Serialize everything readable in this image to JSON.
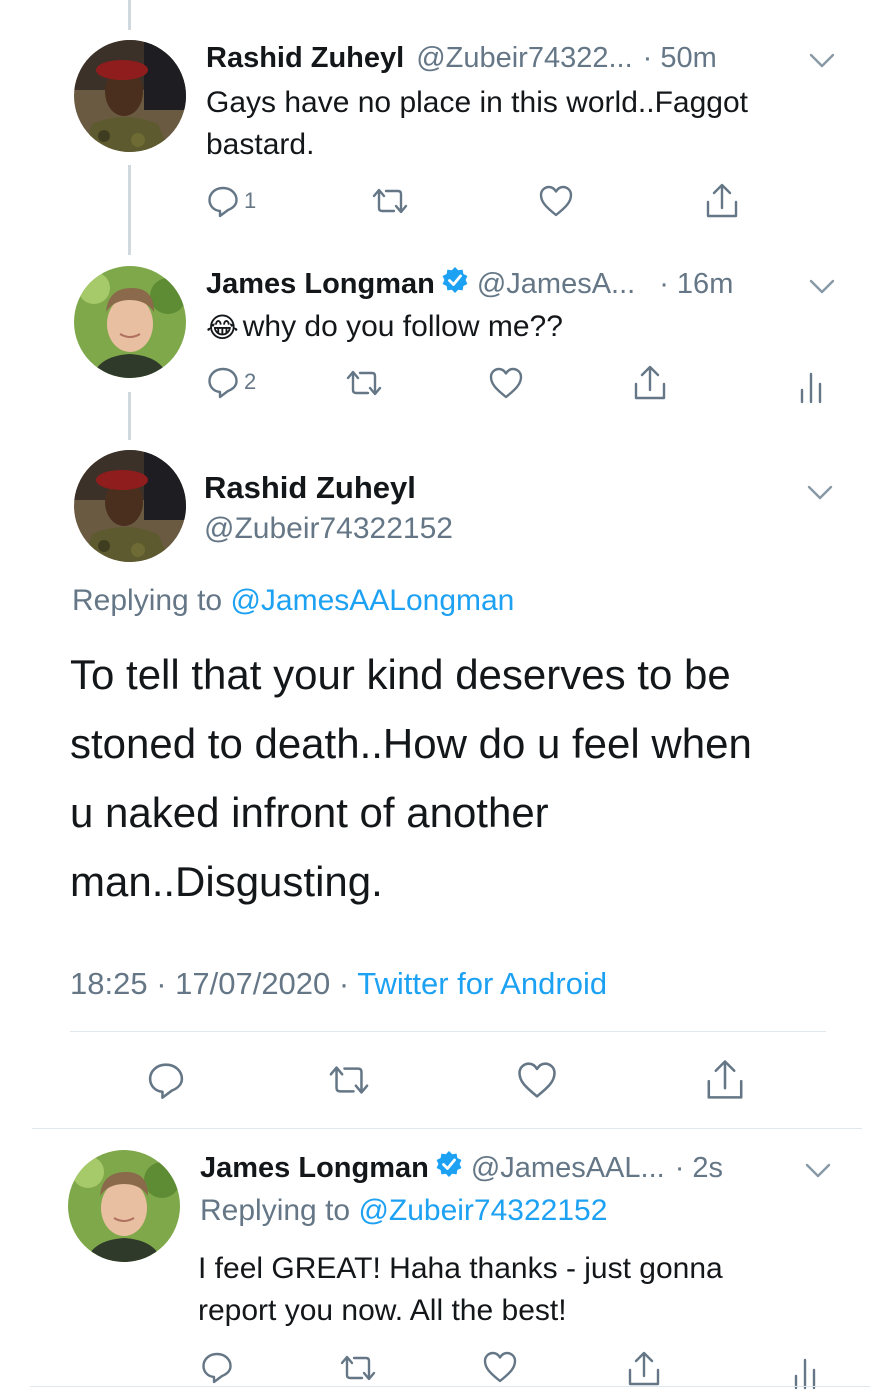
{
  "tweets": [
    {
      "name": "Rashid Zuheyl",
      "handle": "@Zubeir74322...",
      "time": "· 50m",
      "text_line1": "Gays have no place in this world..Faggot",
      "text_line2": "bastard.",
      "reply_count": "1"
    },
    {
      "name": "James Longman",
      "handle": "@JamesA...",
      "time": "· 16m",
      "emoji": "😂",
      "text": "why do you follow me??",
      "reply_count": "2"
    }
  ],
  "focused": {
    "name": "Rashid Zuheyl",
    "handle": "@Zubeir74322152",
    "replying_prefix": "Replying to ",
    "replying_handle": "@JamesAALongman",
    "text_lines": [
      "To tell that your kind deserves to be",
      "stoned to death..How do u feel when",
      "u naked infront of another",
      "man..Disgusting."
    ],
    "timestamp": "18:25 · 17/07/2020 · ",
    "source": "Twitter for Android"
  },
  "reply": {
    "name": "James Longman",
    "handle": "@JamesAAL...",
    "time": "· 2s",
    "replying_prefix": "Replying to ",
    "replying_handle": "@Zubeir74322152",
    "text_line1": "I feel GREAT! Haha thanks - just gonna",
    "text_line2": "report you now. All the best!"
  },
  "colors": {
    "accent": "#1da1f2",
    "muted": "#657786",
    "verified": "#1da1f2"
  },
  "icons": [
    "reply-icon",
    "retweet-icon",
    "like-icon",
    "share-icon",
    "analytics-icon",
    "chevron-down-icon",
    "verified-badge-icon"
  ]
}
